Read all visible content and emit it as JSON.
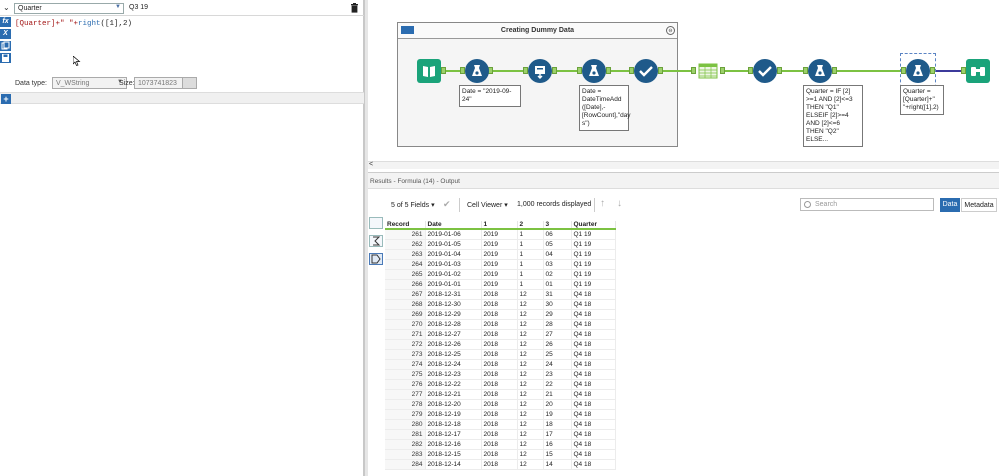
{
  "formula": {
    "field_name": "Quarter",
    "preview": "Q3 19",
    "expression_parts": [
      "[Quarter]+\" \"+",
      "right",
      "([1],2)"
    ],
    "data_type_label": "Data type:",
    "data_type_value": "V_WString",
    "size_label": "Size:",
    "size_value": "1073741823",
    "add_label": "+"
  },
  "vtoolbar": [
    "fx",
    "X",
    "copy",
    "save"
  ],
  "workflow": {
    "container_title": "Creating Dummy Data",
    "collapse_icon": "⊖",
    "annotations": {
      "date1": "Date = \"2019-09-\n24\"",
      "date2": "Date =\nDateTimeAdd\n([Date],-\n[RowCount],\"day\ns\")",
      "quarter_if": "Quarter = IF [2]\n>=1 AND [2]<=3\nTHEN \"Q1\"\nELSEIF [2]>=4\nAND [2]<=6\nTHEN \"Q2\"\nELSE...",
      "quarter_formula": "Quarter =\n[Quarter]+\"\n\"+right([1],2)"
    },
    "scroll_label": "<"
  },
  "results": {
    "header": "Results - Formula (14) - Output",
    "fields_label": "5 of 5 Fields",
    "cell_viewer_label": "Cell Viewer",
    "records_label": "1,000 records displayed",
    "search_placeholder": "Search",
    "data_button": "Data",
    "metadata_button": "Metadata",
    "columns": [
      "Record",
      "Date",
      "1",
      "2",
      "3",
      "Quarter"
    ],
    "rows": [
      [
        "261",
        "2019-01-06",
        "2019",
        "1",
        "06",
        "Q1 19"
      ],
      [
        "262",
        "2019-01-05",
        "2019",
        "1",
        "05",
        "Q1 19"
      ],
      [
        "263",
        "2019-01-04",
        "2019",
        "1",
        "04",
        "Q1 19"
      ],
      [
        "264",
        "2019-01-03",
        "2019",
        "1",
        "03",
        "Q1 19"
      ],
      [
        "265",
        "2019-01-02",
        "2019",
        "1",
        "02",
        "Q1 19"
      ],
      [
        "266",
        "2019-01-01",
        "2019",
        "1",
        "01",
        "Q1 19"
      ],
      [
        "267",
        "2018-12-31",
        "2018",
        "12",
        "31",
        "Q4 18"
      ],
      [
        "268",
        "2018-12-30",
        "2018",
        "12",
        "30",
        "Q4 18"
      ],
      [
        "269",
        "2018-12-29",
        "2018",
        "12",
        "29",
        "Q4 18"
      ],
      [
        "270",
        "2018-12-28",
        "2018",
        "12",
        "28",
        "Q4 18"
      ],
      [
        "271",
        "2018-12-27",
        "2018",
        "12",
        "27",
        "Q4 18"
      ],
      [
        "272",
        "2018-12-26",
        "2018",
        "12",
        "26",
        "Q4 18"
      ],
      [
        "273",
        "2018-12-25",
        "2018",
        "12",
        "25",
        "Q4 18"
      ],
      [
        "274",
        "2018-12-24",
        "2018",
        "12",
        "24",
        "Q4 18"
      ],
      [
        "275",
        "2018-12-23",
        "2018",
        "12",
        "23",
        "Q4 18"
      ],
      [
        "276",
        "2018-12-22",
        "2018",
        "12",
        "22",
        "Q4 18"
      ],
      [
        "277",
        "2018-12-21",
        "2018",
        "12",
        "21",
        "Q4 18"
      ],
      [
        "278",
        "2018-12-20",
        "2018",
        "12",
        "20",
        "Q4 18"
      ],
      [
        "279",
        "2018-12-19",
        "2018",
        "12",
        "19",
        "Q4 18"
      ],
      [
        "280",
        "2018-12-18",
        "2018",
        "12",
        "18",
        "Q4 18"
      ],
      [
        "281",
        "2018-12-17",
        "2018",
        "12",
        "17",
        "Q4 18"
      ],
      [
        "282",
        "2018-12-16",
        "2018",
        "12",
        "16",
        "Q4 18"
      ],
      [
        "283",
        "2018-12-15",
        "2018",
        "12",
        "15",
        "Q4 18"
      ],
      [
        "284",
        "2018-12-14",
        "2018",
        "12",
        "14",
        "Q4 18"
      ]
    ]
  },
  "colors": {
    "accent_blue": "#2b6cb0",
    "tool_navy": "#1f5a8a",
    "tool_teal": "#1aa37a",
    "connector_green": "#7cc242",
    "connector_purple": "#3c3a9b"
  },
  "icons": [
    "input-data-icon",
    "formula-icon",
    "generate-rows-icon",
    "select-icon",
    "text-to-columns-icon",
    "browse-icon",
    "trash-icon",
    "search-icon"
  ]
}
